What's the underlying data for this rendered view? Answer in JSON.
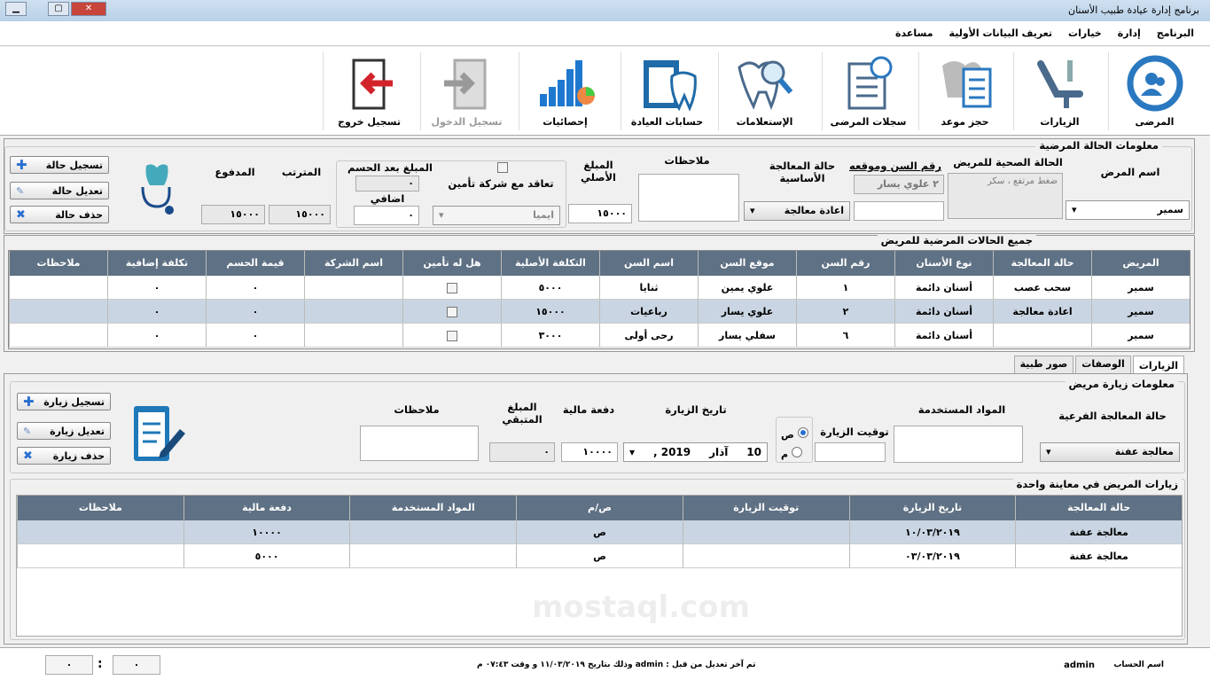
{
  "window": {
    "title": "برنامج إدارة عيادة طبيب الأسنان",
    "min": "▁",
    "max": "▢",
    "close": "✕"
  },
  "menu": [
    "البرنامج",
    "إدارة",
    "خيارات",
    "تعريف البيانات الأولية",
    "مساعدة"
  ],
  "toolbar": [
    {
      "label": "المرضى",
      "icon": "patients-icon",
      "enabled": true
    },
    {
      "label": "الزيارات",
      "icon": "dental-chair-icon",
      "enabled": true
    },
    {
      "label": "حجز موعد",
      "icon": "appointment-icon",
      "enabled": true
    },
    {
      "label": "سجلات المرضى",
      "icon": "records-icon",
      "enabled": true
    },
    {
      "label": "الإستعلامات",
      "icon": "search-tooth-icon",
      "enabled": true
    },
    {
      "label": "حسابات العيادة",
      "icon": "accounts-icon",
      "enabled": true
    },
    {
      "label": "إحصائيات",
      "icon": "statistics-icon",
      "enabled": true
    },
    {
      "label": "تسجيل الدخول",
      "icon": "login-icon",
      "enabled": false
    },
    {
      "label": "تسجيل خروج",
      "icon": "logout-icon",
      "enabled": true
    }
  ],
  "case_info": {
    "title": "معلومات الحالة المرضية",
    "patient_name_label": "اسم المرض",
    "patient_name": "سمير",
    "health_label": "الحالة الصحية للمريض",
    "health_value": "ضغط مرتفع ، سكر",
    "tooth_label": "رقم السن وموقعه",
    "tooth_value": "٢ علوي يسار",
    "tooth_extra": "",
    "treatment_label": "حالة المعالجة الأساسية",
    "treatment_value": "اعادة معالجة",
    "notes_label": "ملاحظات",
    "original_label": "المبلغ الأصلي",
    "original_value": "١٥٠٠٠",
    "insurance_label": "تعاقد مع شركة تأمين",
    "insurance_company": "ايميا",
    "after_discount_label": "المبلغ بعد الحسم",
    "after_discount_value": "٠",
    "extra_label": "اضافي",
    "extra_value": "٠",
    "due_label": "المترتب",
    "due_value": "١٥٠٠٠",
    "paid_label": "المدفوع",
    "paid_value": "١٥٠٠٠",
    "add_btn": "تسجيل حالة",
    "edit_btn": "تعديل حالة",
    "del_btn": "حذف حالة"
  },
  "cases_grid": {
    "title": "جميع الحالات المرضية للمريض",
    "headers": [
      "المريض",
      "حالة المعالجة",
      "نوع الأسنان",
      "رقم السن",
      "موقع السن",
      "اسم السن",
      "التكلفة الأصلية",
      "هل له تأمين",
      "اسم الشركة",
      "قيمة الحسم",
      "تكلفة إضافية",
      "ملاحظات"
    ],
    "rows": [
      [
        "سمير",
        "سحب عصب",
        "أسنان دائمة",
        "١",
        "علوي يمين",
        "ثنايا",
        "٥٠٠٠",
        "",
        "",
        "٠",
        "٠",
        ""
      ],
      [
        "سمير",
        "اعادة معالجة",
        "أسنان دائمة",
        "٢",
        "علوي يسار",
        "رباعيات",
        "١٥٠٠٠",
        "",
        "",
        "٠",
        "٠",
        ""
      ],
      [
        "سمير",
        "",
        "أسنان دائمة",
        "٦",
        "سفلي يسار",
        "رحى أولى",
        "٣٠٠٠",
        "",
        "",
        "٠",
        "٠",
        ""
      ]
    ]
  },
  "tabs": [
    "الزيارات",
    "الوصفات",
    "صور طبية"
  ],
  "visit_info": {
    "title": "معلومات زيارة مريض",
    "sub_treatment_label": "حالة المعالجة الفرعية",
    "sub_treatment_value": "معالجة عفنة",
    "materials_label": "المواد المستخدمة",
    "time_label": "توقيت الزيارة",
    "am": "ص",
    "pm": "م",
    "date_label": "تاريخ الزيارة",
    "date_day": "10",
    "date_month": "آذار",
    "date_year": "2019 ,",
    "payment_label": "دفعة مالية",
    "payment_value": "١٠٠٠٠",
    "remaining_label": "المبلغ المتبقي",
    "remaining_value": "٠",
    "notes_label": "ملاحظات",
    "add_btn": "تسجيل زيارة",
    "edit_btn": "تعديل زيارة",
    "del_btn": "حذف زيارة"
  },
  "visits_grid": {
    "title": "زيارات المريض في معاينة واحدة",
    "headers": [
      "حالة المعالجة",
      "تاريخ الزيارة",
      "توقيت الزيارة",
      "ص/م",
      "المواد المستخدمة",
      "دفعة مالية",
      "ملاحظات"
    ],
    "rows": [
      [
        "معالجة عفنة",
        "١٠/٠٣/٢٠١٩",
        "",
        "ص",
        "",
        "١٠٠٠٠",
        ""
      ],
      [
        "معالجة عفنة",
        "٠٣/٠٣/٢٠١٩",
        "",
        "ص",
        "",
        "٥٠٠٠",
        ""
      ]
    ]
  },
  "status": {
    "account_label": "اسم الحساب",
    "account": "admin",
    "last_edit": "تم آخر تعديل من قبل : admin وذلك بتاريخ ١١/٠٣/٢٠١٩ و وقت ٠٧:٤٣ م",
    "time_a": "٠",
    "sep": ":",
    "time_b": "٠"
  },
  "watermark": "mostaql.com"
}
